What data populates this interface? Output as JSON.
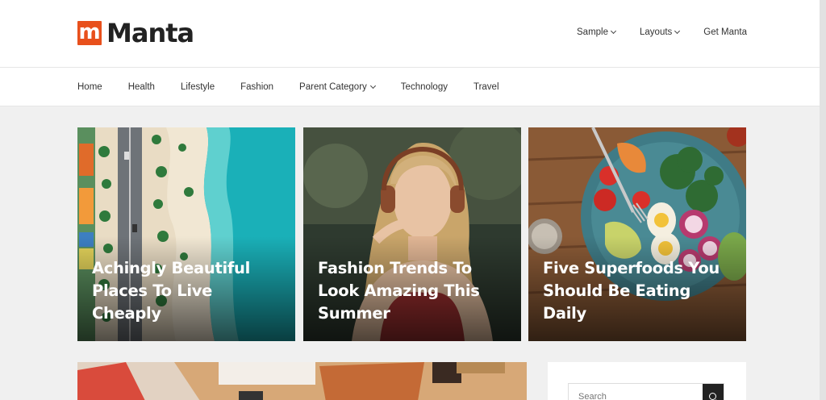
{
  "brand": {
    "logo_letter": "m",
    "name": "Manta",
    "accent": "#e8501c"
  },
  "topnav": [
    {
      "label": "Sample",
      "dropdown": true
    },
    {
      "label": "Layouts",
      "dropdown": true
    },
    {
      "label": "Get Manta",
      "dropdown": false
    }
  ],
  "mainnav": [
    {
      "label": "Home",
      "dropdown": false
    },
    {
      "label": "Health",
      "dropdown": false
    },
    {
      "label": "Lifestyle",
      "dropdown": false
    },
    {
      "label": "Fashion",
      "dropdown": false
    },
    {
      "label": "Parent Category",
      "dropdown": true
    },
    {
      "label": "Technology",
      "dropdown": false
    },
    {
      "label": "Travel",
      "dropdown": false
    }
  ],
  "featured": [
    {
      "title": "Achingly Beautiful Places To Live Cheaply"
    },
    {
      "title": "Fashion Trends To Look Amazing This Summer"
    },
    {
      "title": "Five Superfoods You Should Be Eating Daily"
    }
  ],
  "sidebar": {
    "search_placeholder": "Search"
  }
}
